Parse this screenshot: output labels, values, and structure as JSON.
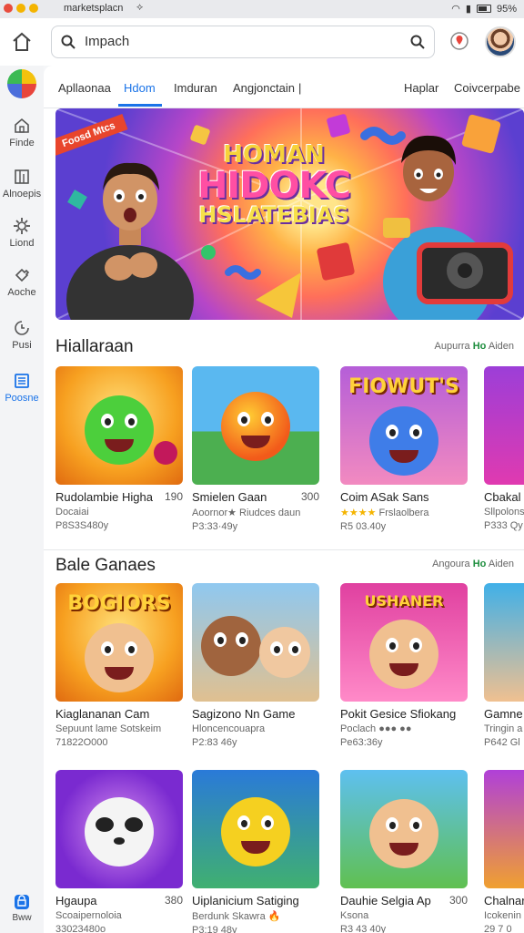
{
  "status": {
    "title": "marketsplacn",
    "arrow": "⟡",
    "battery": "95%"
  },
  "search": {
    "value": "Impach"
  },
  "sidebar": {
    "items": [
      {
        "label": "Finde",
        "icon": "home-icon"
      },
      {
        "label": "Alnoepis",
        "icon": "columns-icon"
      },
      {
        "label": "Liond",
        "icon": "gear-icon"
      },
      {
        "label": "Aoche",
        "icon": "puzzle-icon"
      },
      {
        "label": "Pusi",
        "icon": "clock-icon"
      },
      {
        "label": "Poosne",
        "icon": "document-icon"
      }
    ],
    "bottom": "Bww"
  },
  "tabs": [
    "Apllaonaa",
    "Hdom",
    "Imduran",
    "Angjonctain",
    "|",
    "Haplar",
    "Coivcerpabe"
  ],
  "banner": {
    "tag": "Foosd Mtcs",
    "title_line1": "HOMAN",
    "title_line2": "HIDOKC",
    "title_line3": "HSLATEBIAS"
  },
  "sections": [
    {
      "title": "Hiallaraan",
      "link_prefix": "Aupurra ",
      "link_highlight": "Ho",
      "link_suffix": " Aiden",
      "cards": [
        {
          "title": "Rudolambie Higha",
          "rating": "190",
          "sub": "Docaiai",
          "meta": "P8S3S480y"
        },
        {
          "title": "Smielen Gaan",
          "rating": "300",
          "sub": "Aoornor★ Riudces daun",
          "meta": "P3:33·49y"
        },
        {
          "title": "Coim ASak Sans",
          "rating": "",
          "stars": "★★★★",
          "sub": "Frslaolbera",
          "meta": "R5 03.40y"
        },
        {
          "title": "Cbakal",
          "rating": "",
          "sub": "Sllpolons",
          "meta": "P333 Qy"
        }
      ]
    },
    {
      "title": "Bale Ganaes",
      "link_prefix": "Angoura ",
      "link_highlight": "Ho",
      "link_suffix": " Aiden",
      "cards": [
        {
          "title": "Kiaglananan Cam",
          "rating": "",
          "sub": "Sepuunt lame Sotskeim",
          "meta": "71822O000"
        },
        {
          "title": "Sagizono Nn Game",
          "rating": "",
          "sub": "Hloncencouapra",
          "meta": "P2:83 46y"
        },
        {
          "title": "Pokit Gesice Sfiokang",
          "rating": "",
          "sub": "Poclach ●●● ●●",
          "meta": "Pe63:36y"
        },
        {
          "title": "Gamne",
          "rating": "",
          "sub": "Tringin a",
          "meta": "P642 Gl"
        }
      ]
    },
    {
      "title": "",
      "cards": [
        {
          "title": "Hgaupa",
          "rating": "380",
          "sub": "Scoaipernoloia",
          "meta": "33023480o"
        },
        {
          "title": "Uiplanicium Satiging",
          "rating": "",
          "sub": "Berdunk Skawra 🔥",
          "meta": "P3:19 48y"
        },
        {
          "title": "Dauhie Selgia Ap",
          "rating": "300",
          "sub": "Ksona",
          "meta": "R3 43 40y"
        },
        {
          "title": "Chalnar",
          "rating": "",
          "sub": "Icokenin",
          "meta": "29 7 0"
        }
      ]
    }
  ],
  "thumb_texts": [
    "",
    "",
    "FIOWUT'S",
    "",
    "BOGIORS",
    "",
    "USHANER",
    "",
    "",
    "",
    "",
    ""
  ],
  "colors": {
    "accent": "#1a73e8",
    "link_highlight": "#1e8e3e",
    "star": "#f4b400"
  }
}
